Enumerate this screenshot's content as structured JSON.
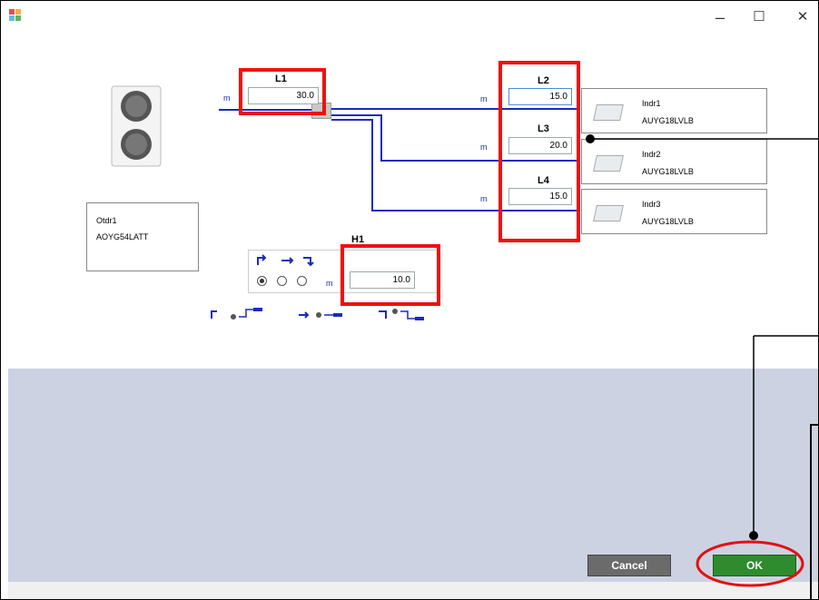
{
  "window": {
    "minimize_glyph": "–",
    "maximize_glyph": "☐",
    "close_glyph": "✕"
  },
  "outdoor": {
    "name": "Otdr1",
    "model": "AOYG54LATT"
  },
  "fields": {
    "L1": {
      "label": "L1",
      "unit": "m",
      "value": "30.0"
    },
    "L2": {
      "label": "L2",
      "unit": "m",
      "value": "15.0"
    },
    "L3": {
      "label": "L3",
      "unit": "m",
      "value": "20.0"
    },
    "L4": {
      "label": "L4",
      "unit": "m",
      "value": "15.0"
    },
    "H1": {
      "label": "H1",
      "unit": "m",
      "value": "10.0"
    }
  },
  "indoor": [
    {
      "name": "Indr1",
      "model": "AUYG18LVLB"
    },
    {
      "name": "Indr2",
      "model": "AUYG18LVLB"
    },
    {
      "name": "Indr3",
      "model": "AUYG18LVLB"
    }
  ],
  "height_options": {
    "selected_index": 0
  },
  "buttons": {
    "cancel": "Cancel",
    "ok": "OK"
  },
  "colors": {
    "pipe": "#1a2bbf",
    "highlight": "#e11111",
    "ok_button": "#2e8b2e",
    "cancel_button": "#6b6b6b"
  }
}
